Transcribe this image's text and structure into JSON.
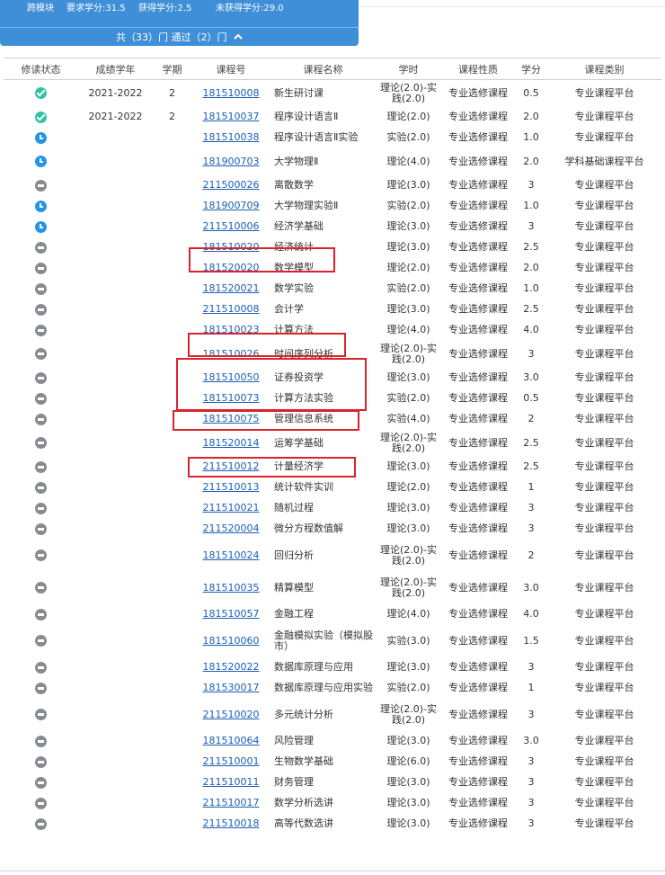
{
  "summary": {
    "module": "跨模块",
    "required": "要求学分:31.5",
    "earned": "获得学分:2.5",
    "unearned": "未获得学分:29.0"
  },
  "toggle": {
    "label": "共（33）门 通过（2）门",
    "chevron": "chevron-up-icon"
  },
  "columns": [
    "修读状态",
    "成绩学年",
    "学期",
    "课程号",
    "课程名称",
    "学时",
    "课程性质",
    "学分",
    "课程类别"
  ],
  "colors": {
    "passed": "#2fc3a2",
    "in_progress": "#2196e8",
    "not_taken": "#888c90",
    "link": "#1b5fb5",
    "highlight": "#d9232d",
    "header_bg": "#3f8fd8"
  },
  "rows": [
    {
      "status": "passed",
      "year": "2021-2022",
      "term": "2",
      "code": "181510008",
      "name": "新生研讨课",
      "hours": "理论(2.0)-实践(2.0)",
      "nature": "专业选修课程",
      "credit": "0.5",
      "category": "专业课程平台"
    },
    {
      "status": "passed",
      "year": "2021-2022",
      "term": "2",
      "code": "181510037",
      "name": "程序设计语言Ⅱ",
      "hours": "理论(2.0)",
      "nature": "专业选修课程",
      "credit": "2.0",
      "category": "专业课程平台"
    },
    {
      "status": "in_progress",
      "year": "",
      "term": "",
      "code": "181510038",
      "name": "程序设计语言Ⅱ实验",
      "hours": "实验(2.0)",
      "nature": "专业选修课程",
      "credit": "1.0",
      "category": "专业课程平台"
    },
    {
      "status": "in_progress",
      "year": "",
      "term": "",
      "code": "181900703",
      "name": "大学物理Ⅱ",
      "hours": "理论(4.0)",
      "nature": "专业选修课程",
      "credit": "2.0",
      "category": "学科基础课程平台"
    },
    {
      "status": "not_taken",
      "year": "",
      "term": "",
      "code": "211500026",
      "name": "离散数学",
      "hours": "理论(3.0)",
      "nature": "专业选修课程",
      "credit": "3",
      "category": "专业课程平台"
    },
    {
      "status": "in_progress",
      "year": "",
      "term": "",
      "code": "181900709",
      "name": "大学物理实验Ⅱ",
      "hours": "实验(2.0)",
      "nature": "专业选修课程",
      "credit": "1.0",
      "category": "专业课程平台"
    },
    {
      "status": "in_progress",
      "year": "",
      "term": "",
      "code": "211510006",
      "name": "经济学基础",
      "hours": "理论(3.0)",
      "nature": "专业选修课程",
      "credit": "3",
      "category": "专业课程平台"
    },
    {
      "status": "not_taken",
      "year": "",
      "term": "",
      "code": "181510020",
      "name": "经济统计",
      "hours": "理论(3.0)",
      "nature": "专业选修课程",
      "credit": "2.5",
      "category": "专业课程平台"
    },
    {
      "status": "not_taken",
      "year": "",
      "term": "",
      "code": "181520020",
      "name": "数学模型",
      "hours": "理论(2.0)",
      "nature": "专业选修课程",
      "credit": "2.0",
      "category": "专业课程平台"
    },
    {
      "status": "not_taken",
      "year": "",
      "term": "",
      "code": "181520021",
      "name": "数学实验",
      "hours": "实验(2.0)",
      "nature": "专业选修课程",
      "credit": "1.0",
      "category": "专业课程平台"
    },
    {
      "status": "not_taken",
      "year": "",
      "term": "",
      "code": "211510008",
      "name": "会计学",
      "hours": "理论(3.0)",
      "nature": "专业选修课程",
      "credit": "2.5",
      "category": "专业课程平台"
    },
    {
      "status": "not_taken",
      "year": "",
      "term": "",
      "code": "181510023",
      "name": "计算方法",
      "hours": "理论(4.0)",
      "nature": "专业选修课程",
      "credit": "4.0",
      "category": "专业课程平台"
    },
    {
      "status": "not_taken",
      "year": "",
      "term": "",
      "code": "181510026",
      "name": "时间序列分析",
      "hours": "理论(2.0)-实践(2.0)",
      "nature": "专业选修课程",
      "credit": "3",
      "category": "专业课程平台"
    },
    {
      "status": "not_taken",
      "year": "",
      "term": "",
      "code": "181510050",
      "name": "证券投资学",
      "hours": "理论(3.0)",
      "nature": "专业选修课程",
      "credit": "3.0",
      "category": "专业课程平台"
    },
    {
      "status": "not_taken",
      "year": "",
      "term": "",
      "code": "181510073",
      "name": "计算方法实验",
      "hours": "实验(2.0)",
      "nature": "专业选修课程",
      "credit": "0.5",
      "category": "专业课程平台"
    },
    {
      "status": "not_taken",
      "year": "",
      "term": "",
      "code": "181510075",
      "name": "管理信息系统",
      "hours": "实验(4.0)",
      "nature": "专业选修课程",
      "credit": "2",
      "category": "专业课程平台"
    },
    {
      "status": "not_taken",
      "year": "",
      "term": "",
      "code": "181520014",
      "name": "运筹学基础",
      "hours": "理论(2.0)-实践(2.0)",
      "nature": "专业选修课程",
      "credit": "2.5",
      "category": "专业课程平台"
    },
    {
      "status": "not_taken",
      "year": "",
      "term": "",
      "code": "211510012",
      "name": "计量经济学",
      "hours": "理论(3.0)",
      "nature": "专业选修课程",
      "credit": "2.5",
      "category": "专业课程平台"
    },
    {
      "status": "not_taken",
      "year": "",
      "term": "",
      "code": "211510013",
      "name": "统计软件实训",
      "hours": "理论(2.0)",
      "nature": "专业选修课程",
      "credit": "1",
      "category": "专业课程平台"
    },
    {
      "status": "not_taken",
      "year": "",
      "term": "",
      "code": "211510021",
      "name": "随机过程",
      "hours": "理论(3.0)",
      "nature": "专业选修课程",
      "credit": "3",
      "category": "专业课程平台"
    },
    {
      "status": "not_taken",
      "year": "",
      "term": "",
      "code": "211520004",
      "name": "微分方程数值解",
      "hours": "理论(3.0)",
      "nature": "专业选修课程",
      "credit": "3",
      "category": "专业课程平台"
    },
    {
      "status": "not_taken",
      "year": "",
      "term": "",
      "code": "181510024",
      "name": "回归分析",
      "hours": "理论(2.0)-实践(2.0)",
      "nature": "专业选修课程",
      "credit": "2",
      "category": "专业课程平台"
    },
    {
      "status": "not_taken",
      "year": "",
      "term": "",
      "code": "181510035",
      "name": "精算模型",
      "hours": "理论(2.0)-实践(2.0)",
      "nature": "专业选修课程",
      "credit": "3.0",
      "category": "专业课程平台"
    },
    {
      "status": "not_taken",
      "year": "",
      "term": "",
      "code": "181510057",
      "name": "金融工程",
      "hours": "理论(4.0)",
      "nature": "专业选修课程",
      "credit": "4.0",
      "category": "专业课程平台"
    },
    {
      "status": "not_taken",
      "year": "",
      "term": "",
      "code": "181510060",
      "name": "金融模拟实验（模拟股市）",
      "hours": "实验(3.0)",
      "nature": "专业选修课程",
      "credit": "1.5",
      "category": "专业课程平台"
    },
    {
      "status": "not_taken",
      "year": "",
      "term": "",
      "code": "181520022",
      "name": "数据库原理与应用",
      "hours": "理论(3.0)",
      "nature": "专业选修课程",
      "credit": "3",
      "category": "专业课程平台"
    },
    {
      "status": "not_taken",
      "year": "",
      "term": "",
      "code": "181530017",
      "name": "数据库原理与应用实验",
      "hours": "实验(2.0)",
      "nature": "专业选修课程",
      "credit": "1",
      "category": "专业课程平台"
    },
    {
      "status": "not_taken",
      "year": "",
      "term": "",
      "code": "211510020",
      "name": "多元统计分析",
      "hours": "理论(2.0)-实践(2.0)",
      "nature": "专业选修课程",
      "credit": "3",
      "category": "专业课程平台"
    },
    {
      "status": "not_taken",
      "year": "",
      "term": "",
      "code": "181510064",
      "name": "风险管理",
      "hours": "理论(3.0)",
      "nature": "专业选修课程",
      "credit": "3.0",
      "category": "专业课程平台"
    },
    {
      "status": "not_taken",
      "year": "",
      "term": "",
      "code": "211510001",
      "name": "生物数学基础",
      "hours": "理论(6.0)",
      "nature": "专业选修课程",
      "credit": "3",
      "category": "专业课程平台"
    },
    {
      "status": "not_taken",
      "year": "",
      "term": "",
      "code": "211510011",
      "name": "财务管理",
      "hours": "理论(3.0)",
      "nature": "专业选修课程",
      "credit": "3",
      "category": "专业课程平台"
    },
    {
      "status": "not_taken",
      "year": "",
      "term": "",
      "code": "211510017",
      "name": "数学分析选讲",
      "hours": "理论(3.0)",
      "nature": "专业选修课程",
      "credit": "3",
      "category": "专业课程平台"
    },
    {
      "status": "not_taken",
      "year": "",
      "term": "",
      "code": "211510018",
      "name": "高等代数选讲",
      "hours": "理论(3.0)",
      "nature": "专业选修课程",
      "credit": "3",
      "category": "专业课程平台"
    }
  ]
}
